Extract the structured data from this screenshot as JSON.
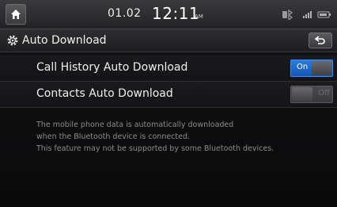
{
  "status_bar": {
    "home_icon": "home-icon",
    "date": "01.02",
    "time": "12:11",
    "ampm": "AM",
    "icons": [
      "bluetooth-phone-icon",
      "signal-strength-icon",
      "battery-icon"
    ]
  },
  "header": {
    "settings_icon": "gear-icon",
    "title": "Auto Download",
    "back_icon": "back-arrow-icon"
  },
  "settings": [
    {
      "label": "Call History Auto Download",
      "state": "On",
      "enabled": true
    },
    {
      "label": "Contacts Auto Download",
      "state": "Off",
      "enabled": false
    }
  ],
  "description": [
    "The mobile phone data is automatically downloaded",
    "when the Bluetooth device is connected.",
    "This feature may not be supported by some Bluetooth devices."
  ],
  "colors": {
    "toggle_on": "#1f6ad0",
    "toggle_off": "#3f3f41",
    "background": "#0c0c0d"
  }
}
